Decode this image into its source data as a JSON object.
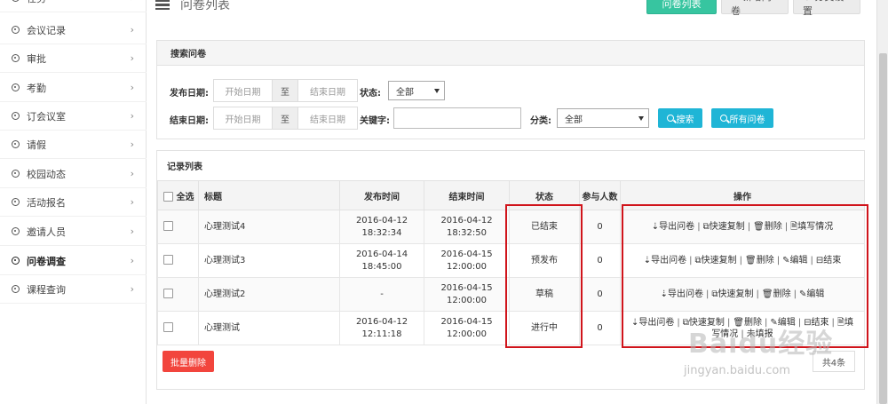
{
  "sidebar": {
    "items": [
      {
        "label": "任务",
        "active": false
      },
      {
        "label": "会议记录",
        "active": false
      },
      {
        "label": "审批",
        "active": false
      },
      {
        "label": "考勤",
        "active": false
      },
      {
        "label": "订会议室",
        "active": false
      },
      {
        "label": "请假",
        "active": false
      },
      {
        "label": "校园动态",
        "active": false
      },
      {
        "label": "活动报名",
        "active": false
      },
      {
        "label": "邀请人员",
        "active": false
      },
      {
        "label": "问卷调查",
        "active": true
      },
      {
        "label": "课程查询",
        "active": false
      }
    ],
    "chevron": "›"
  },
  "header": {
    "title": "问卷列表",
    "buttons": {
      "list": "问卷列表",
      "add": "✚ 新增问卷",
      "settings": "⚙ 分类设置"
    }
  },
  "search": {
    "panel_title": "搜索问卷",
    "publish_date_label": "发布日期:",
    "end_date_label": "结束日期:",
    "start_placeholder": "开始日期",
    "end_placeholder": "结束日期",
    "to": "至",
    "status_label": "状态:",
    "status_value": "全部",
    "keyword_label": "关键字:",
    "keyword_value": "",
    "category_label": "分类:",
    "category_value": "全部",
    "search_button": "搜索",
    "all_button": "所有问卷"
  },
  "records": {
    "panel_title": "记录列表",
    "columns": {
      "select_all": "全选",
      "title": "标题",
      "publish_time": "发布时间",
      "end_time": "结束时间",
      "status": "状态",
      "participants": "参与人数",
      "actions": "操作"
    },
    "rows": [
      {
        "title": "心理测试4",
        "publish_date": "2016-04-12",
        "publish_time": "18:32:34",
        "end_date": "2016-04-12",
        "end_time": "18:32:50",
        "status": "已结束",
        "participants": "0",
        "ops_line1": [
          "⇣导出问卷",
          "⧉快速复制",
          "🗑删除",
          "🗎填写情况"
        ],
        "ops_line2": []
      },
      {
        "title": "心理测试3",
        "publish_date": "2016-04-14",
        "publish_time": "18:45:00",
        "end_date": "2016-04-15",
        "end_time": "12:00:00",
        "status": "预发布",
        "participants": "0",
        "ops_line1": [
          "⇣导出问卷",
          "⧉快速复制",
          "🗑删除",
          "✎编辑",
          "⊟结束"
        ],
        "ops_line2": []
      },
      {
        "title": "心理测试2",
        "publish_date": "-",
        "publish_time": "",
        "end_date": "2016-04-15",
        "end_time": "12:00:00",
        "status": "草稿",
        "participants": "0",
        "ops_line1": [
          "⇣导出问卷",
          "⧉快速复制",
          "🗑删除",
          "✎编辑"
        ],
        "ops_line2": []
      },
      {
        "title": "心理测试",
        "publish_date": "2016-04-12",
        "publish_time": "12:11:18",
        "end_date": "2016-04-15",
        "end_time": "12:00:00",
        "status": "进行中",
        "participants": "0",
        "ops_line1": [
          "⇣导出问卷",
          "⧉快速复制",
          "🗑删除",
          "✎编辑",
          "⊟结束",
          "🗎填"
        ],
        "ops_line2": [
          "写情况",
          "未填报"
        ]
      }
    ],
    "batch_delete": "批量删除",
    "total": "共4条"
  },
  "watermark": {
    "main": "Baidu经验",
    "sub": "jingyan.baidu.com"
  },
  "colors": {
    "green": "#37c5a0",
    "blue": "#1fb5d6",
    "red": "#f2453d",
    "highlight": "#d0141b"
  }
}
